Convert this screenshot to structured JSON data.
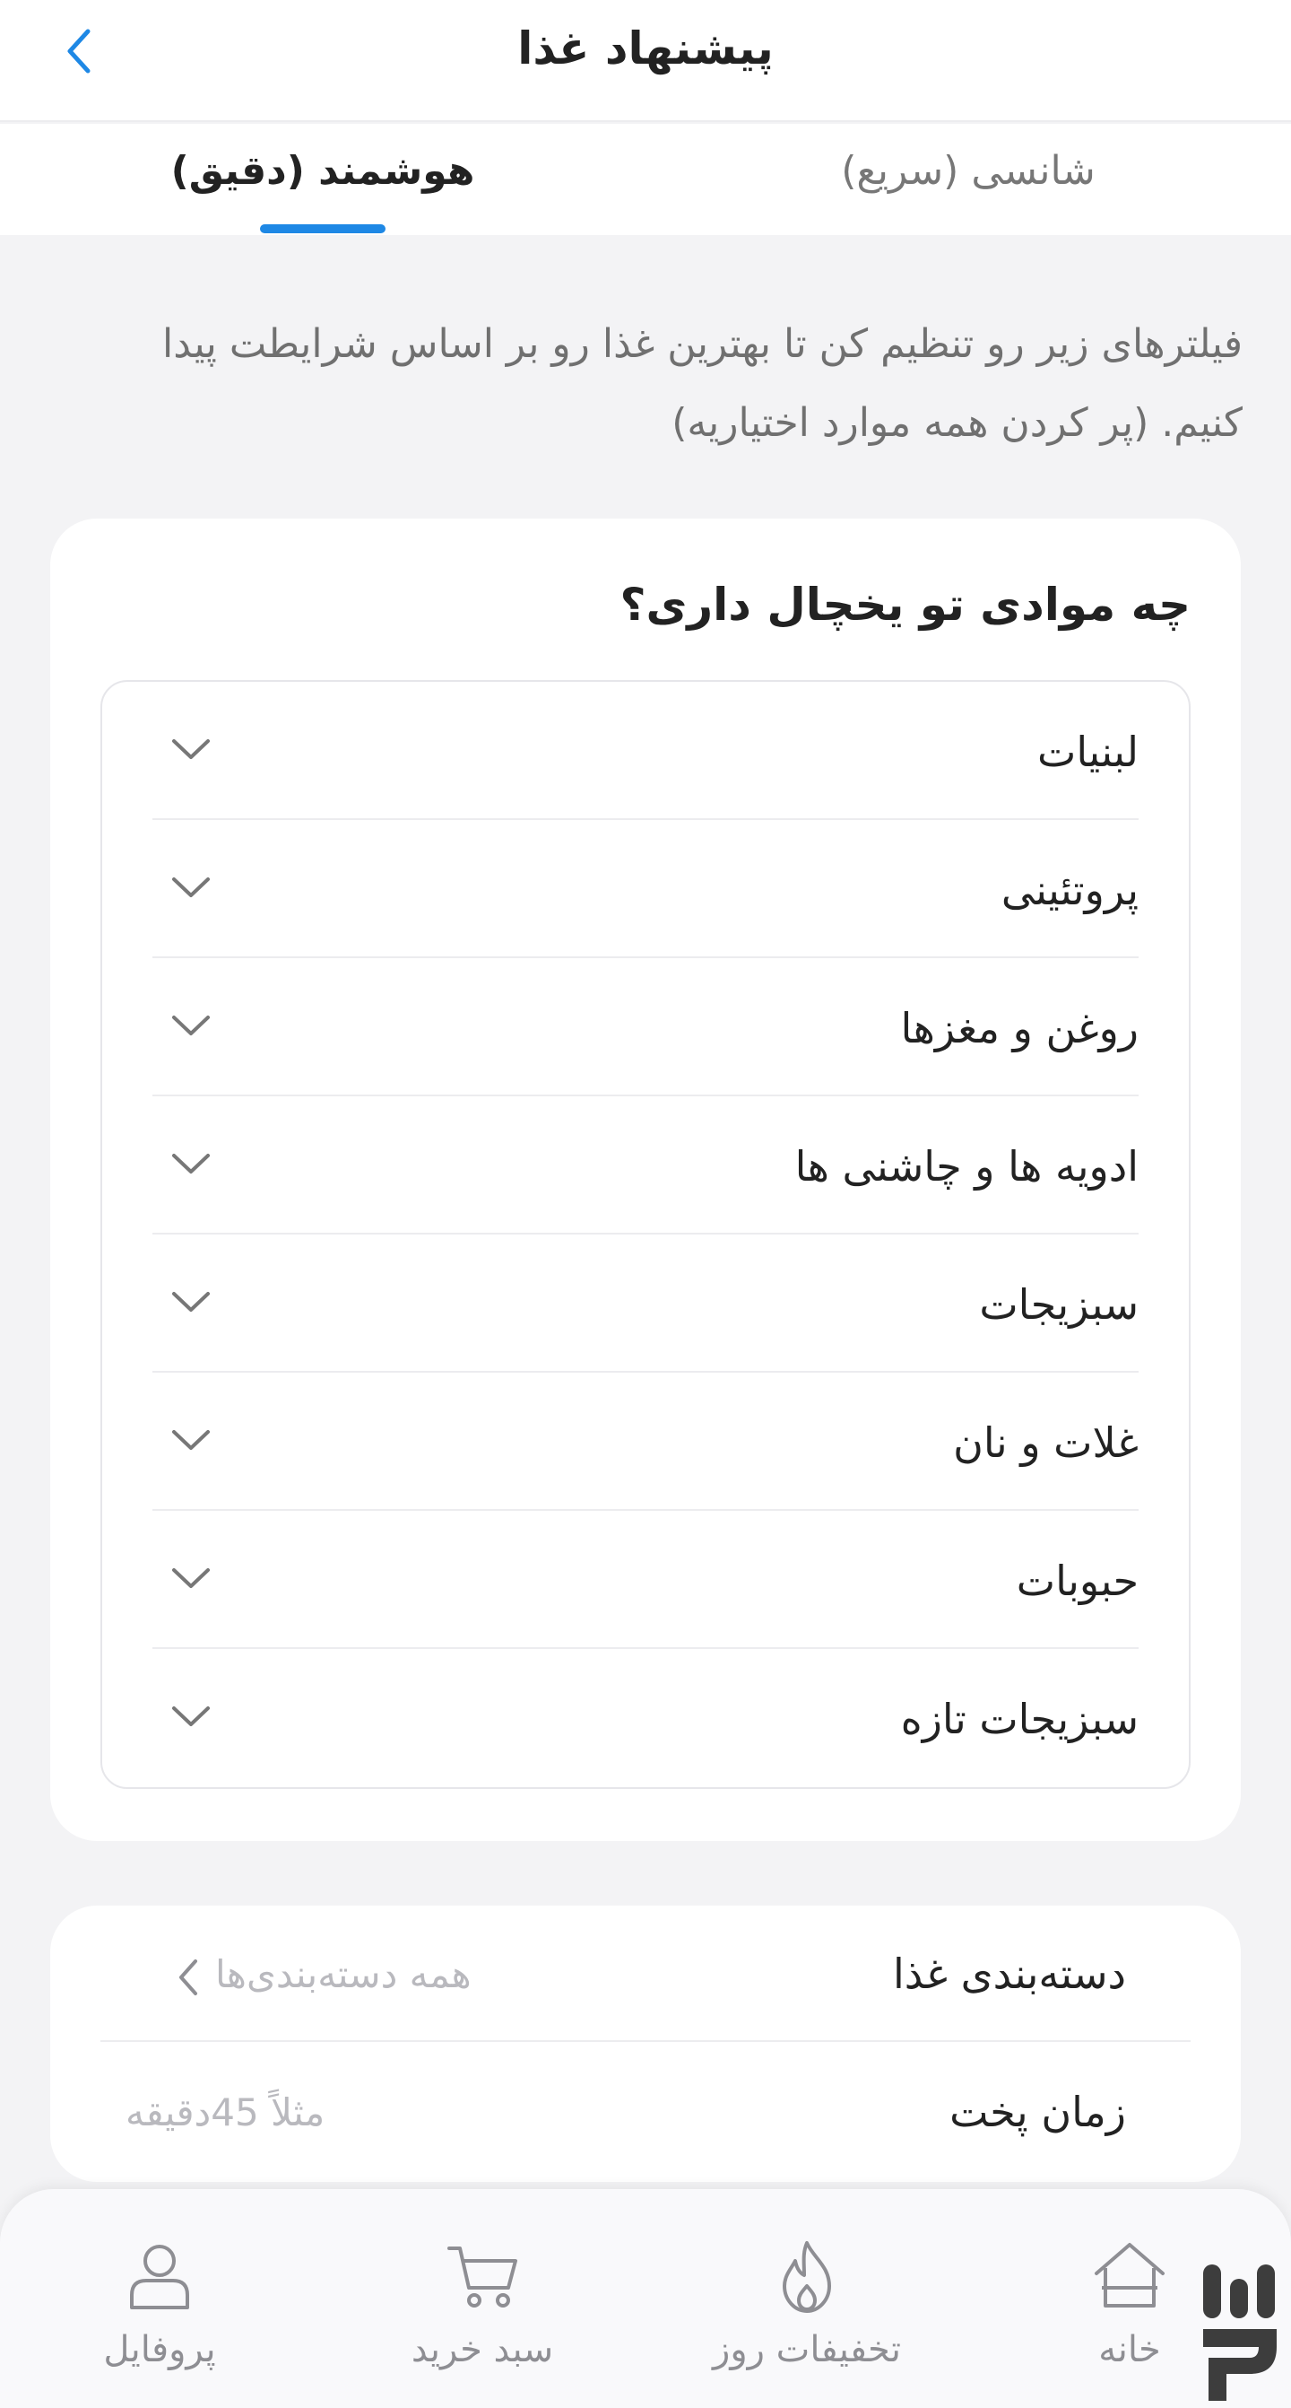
{
  "header": {
    "title": "پیشنهاد غذا",
    "back_icon": "chevron-left-icon"
  },
  "tabs": [
    {
      "label": "شانسی (سریع)",
      "active": false
    },
    {
      "label": "هوشمند (دقیق)",
      "active": true
    }
  ],
  "description": "فیلترهای زیر رو تنظیم کن تا بهترین غذا رو بر اساس شرایطت پیدا کنیم. (پر کردن همه موارد اختیاریه)",
  "ingredients": {
    "title": "چه موادی تو یخچال داری؟",
    "categories": [
      "لبنیات",
      "پروتئینی",
      "روغن و مغزها",
      "ادویه ها و چاشنی ها",
      "سبزیجات",
      "غلات و نان",
      "حبوبات",
      "سبزیجات تازه"
    ]
  },
  "options": {
    "category": {
      "label": "دسته‌بندی غذا",
      "value": "همه دسته‌بندی‌ها"
    },
    "cook_time": {
      "label": "زمان پخت",
      "placeholder": "مثلاً 45دقیقه"
    }
  },
  "bottom_nav": [
    {
      "label": "پروفایل",
      "icon": "user-icon"
    },
    {
      "label": "سبد خرید",
      "icon": "cart-icon"
    },
    {
      "label": "تخفیفات روز",
      "icon": "flame-icon"
    },
    {
      "label": "خانه",
      "icon": "home-icon"
    }
  ],
  "colors": {
    "accent": "#1e88e5",
    "background": "#f3f3f5",
    "text": "#222222",
    "muted": "#8e8e93"
  }
}
